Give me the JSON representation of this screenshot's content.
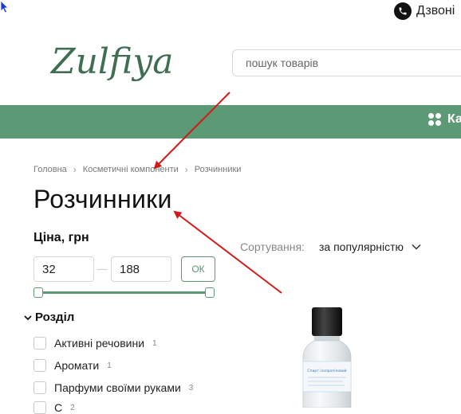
{
  "header": {
    "phone_label": "Дзвоні",
    "logo_text": "Zulfiya",
    "search_placeholder": "пошук товарів"
  },
  "navbar": {
    "catalog_label": "Ка"
  },
  "breadcrumb": [
    "Головна",
    "Косметичні компоненти",
    "Розчинники"
  ],
  "page_title": "Розчинники",
  "price_filter": {
    "label": "Ціна, грн",
    "min_value": "32",
    "max_value": "188",
    "ok_label": "ОК",
    "range_fraction_low": 0,
    "range_fraction_high": 1
  },
  "sort": {
    "label": "Сортування:",
    "value": "за популярністю"
  },
  "section_filter": {
    "title": "Розділ",
    "items": [
      {
        "label": "Активні речовини",
        "count": "1"
      },
      {
        "label": "Аромати",
        "count": "1"
      },
      {
        "label": "Парфуми своїми руками",
        "count": "3"
      },
      {
        "label": "С",
        "count": "2"
      }
    ]
  },
  "product_image": {
    "label": "Спирт ізопропіловий"
  },
  "colors": {
    "brand_green": "#5b9a75",
    "annotation_arrow": "#d11a1a",
    "logo_green": "#3f6e52"
  }
}
